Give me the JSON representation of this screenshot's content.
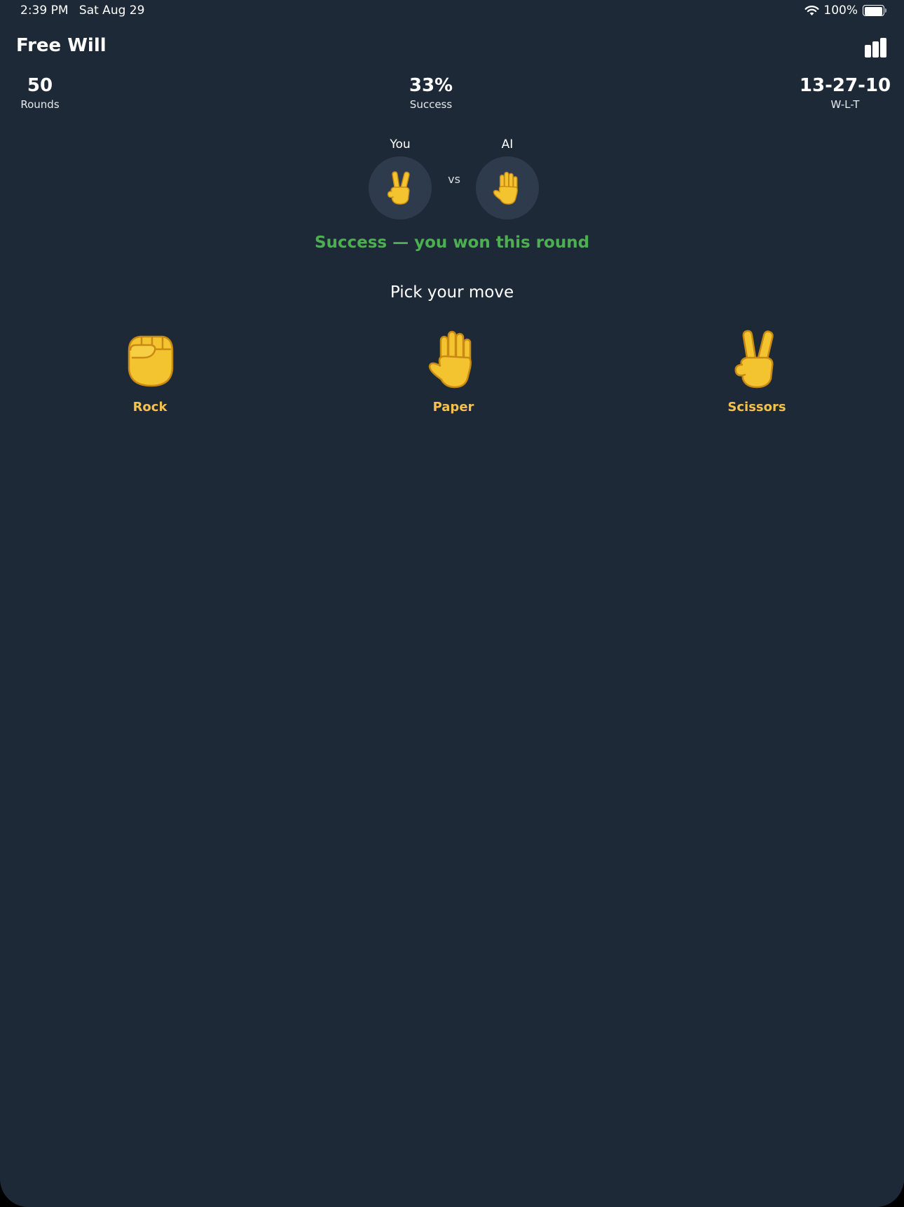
{
  "status_bar": {
    "time": "2:39 PM",
    "date": "Sat Aug 29",
    "battery": "100%"
  },
  "nav": {
    "title": "Free Will"
  },
  "stats": {
    "rounds": {
      "value": "50",
      "label": "Rounds"
    },
    "success": {
      "value": "33%",
      "label": "Success"
    },
    "record": {
      "value": "13-27-10",
      "label": "W-L-T"
    }
  },
  "versus": {
    "you_label": "You",
    "ai_label": "AI",
    "vs": "vs",
    "you_move": "scissors",
    "ai_move": "paper"
  },
  "result": {
    "text": "Success — you won this round",
    "color": "#4caf50"
  },
  "prompt": "Pick your move",
  "moves": [
    {
      "label": "Rock",
      "icon": "rock-fist-icon"
    },
    {
      "label": "Paper",
      "icon": "paper-hand-icon"
    },
    {
      "label": "Scissors",
      "icon": "scissors-victory-hand-icon"
    }
  ],
  "colors": {
    "background": "#1e2937",
    "accent": "#f2c14e",
    "success": "#4caf50",
    "circle": "#2e3b4c"
  }
}
